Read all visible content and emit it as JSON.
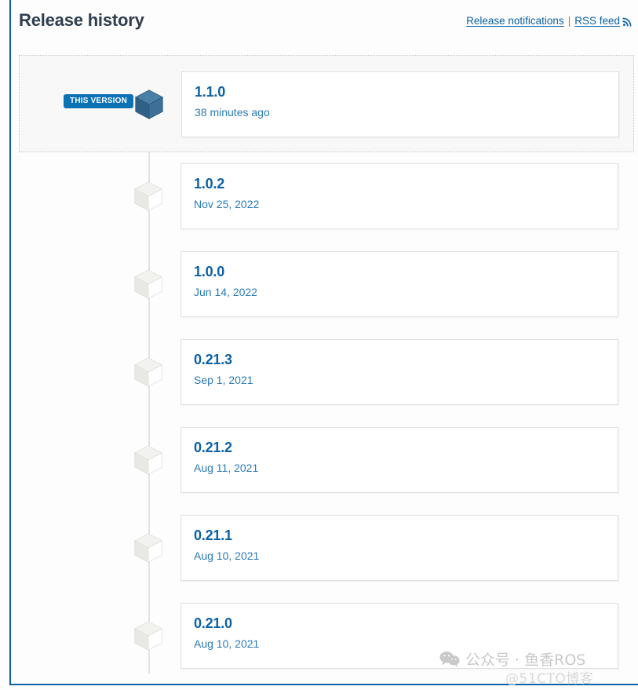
{
  "header": {
    "title": "Release history",
    "links": {
      "release_notifications": "Release notifications",
      "separator": "|",
      "rss_feed": "RSS feed",
      "rss_icon": "rss-icon"
    }
  },
  "timeline": {
    "current_badge_label": "THIS VERSION",
    "releases": [
      {
        "version": "1.1.0",
        "date": "38 minutes ago",
        "current": true,
        "cube": "cube-icon-active"
      },
      {
        "version": "1.0.2",
        "date": "Nov 25, 2022",
        "current": false,
        "cube": "cube-icon"
      },
      {
        "version": "1.0.0",
        "date": "Jun 14, 2022",
        "current": false,
        "cube": "cube-icon"
      },
      {
        "version": "0.21.3",
        "date": "Sep 1, 2021",
        "current": false,
        "cube": "cube-icon"
      },
      {
        "version": "0.21.2",
        "date": "Aug 11, 2021",
        "current": false,
        "cube": "cube-icon"
      },
      {
        "version": "0.21.1",
        "date": "Aug 10, 2021",
        "current": false,
        "cube": "cube-icon"
      },
      {
        "version": "0.21.0",
        "date": "Aug 10, 2021",
        "current": false,
        "cube": "cube-icon"
      }
    ]
  },
  "watermark": {
    "text": "公众号 · 鱼香ROS",
    "subtext": "@51CTO博客",
    "icon": "wechat-icon"
  },
  "colors": {
    "accent_blue": "#0b61a4",
    "badge_blue": "#0b72b5",
    "date_blue": "#2a7ab5",
    "title_dark": "#2f3e4e",
    "card_border": "#e0e0e0",
    "timeline_line": "#e3e3e3",
    "current_row_bg": "#f8f8f8"
  }
}
